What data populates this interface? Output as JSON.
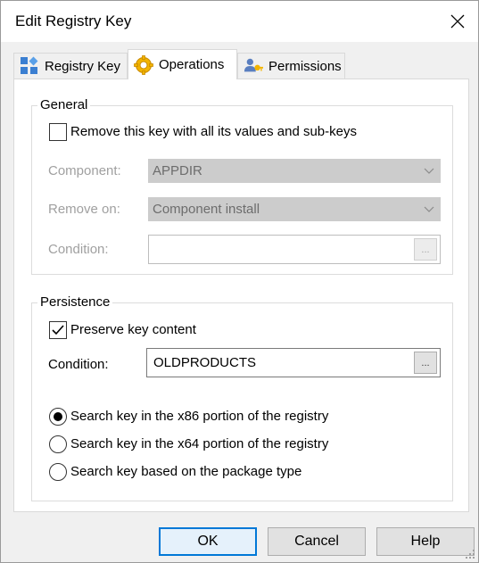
{
  "window": {
    "title": "Edit Registry Key"
  },
  "tabs": [
    {
      "label": "Registry Key",
      "icon": "registry-key-icon",
      "active": false
    },
    {
      "label": "Operations",
      "icon": "gear-icon",
      "active": true
    },
    {
      "label": "Permissions",
      "icon": "permissions-icon",
      "active": false
    }
  ],
  "general": {
    "title": "General",
    "remove_key_label": "Remove this key with all its values and sub-keys",
    "remove_key_checked": false,
    "component_label": "Component:",
    "component_value": "APPDIR",
    "remove_on_label": "Remove on:",
    "remove_on_value": "Component install",
    "condition_label": "Condition:",
    "condition_value": "",
    "ellipsis": "..."
  },
  "persistence": {
    "title": "Persistence",
    "preserve_label": "Preserve key content",
    "preserve_checked": true,
    "condition_label": "Condition:",
    "condition_value": "OLDPRODUCTS",
    "ellipsis": "...",
    "radios": [
      {
        "label": "Search key in the x86 portion of the registry",
        "selected": true
      },
      {
        "label": "Search key in the x64 portion of the registry",
        "selected": false
      },
      {
        "label": "Search key based on the package type",
        "selected": false
      }
    ]
  },
  "buttons": {
    "ok": "OK",
    "cancel": "Cancel",
    "help": "Help"
  },
  "colors": {
    "accent": "#0078d7",
    "disabled_text": "#a0a0a0",
    "disabled_combo": "#cccccc"
  }
}
